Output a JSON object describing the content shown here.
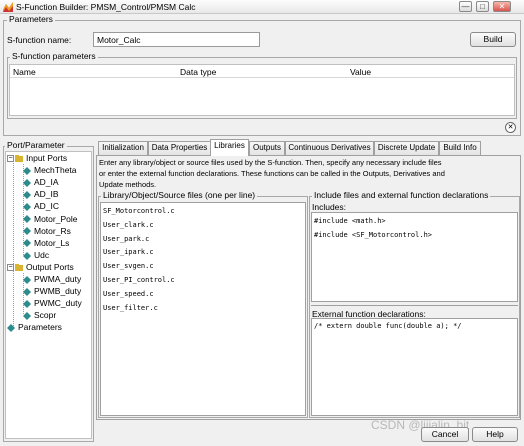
{
  "window": {
    "title": "S-Function Builder: PMSM_Control/PMSM Calc",
    "buttons": {
      "minimize": "—",
      "restore": "□",
      "close": "✕"
    }
  },
  "parameters": {
    "group_label": "Parameters",
    "name_label": "S-function name:",
    "name_value": "Motor_Calc",
    "build_label": "Build",
    "sfun_params_label": "S-function parameters",
    "columns": [
      "Name",
      "Data type",
      "Value"
    ]
  },
  "port_parameter": {
    "group_label": "Port/Parameter",
    "tree": [
      {
        "label": "Input Ports",
        "level": 0,
        "kind": "folder"
      },
      {
        "label": "MechTheta",
        "level": 1,
        "kind": "port"
      },
      {
        "label": "AD_IA",
        "level": 1,
        "kind": "port"
      },
      {
        "label": "AD_IB",
        "level": 1,
        "kind": "port"
      },
      {
        "label": "AD_IC",
        "level": 1,
        "kind": "port"
      },
      {
        "label": "Motor_Pole",
        "level": 1,
        "kind": "port"
      },
      {
        "label": "Motor_Rs",
        "level": 1,
        "kind": "port"
      },
      {
        "label": "Motor_Ls",
        "level": 1,
        "kind": "port"
      },
      {
        "label": "Udc",
        "level": 1,
        "kind": "port"
      },
      {
        "label": "Output Ports",
        "level": 0,
        "kind": "folder"
      },
      {
        "label": "PWMA_duty",
        "level": 1,
        "kind": "port"
      },
      {
        "label": "PWMB_duty",
        "level": 1,
        "kind": "port"
      },
      {
        "label": "PWMC_duty",
        "level": 1,
        "kind": "port"
      },
      {
        "label": "Scopr",
        "level": 1,
        "kind": "port"
      },
      {
        "label": "Parameters",
        "level": 0,
        "kind": "leaf"
      }
    ]
  },
  "tabs": [
    {
      "label": "Initialization",
      "active": false
    },
    {
      "label": "Data Properties",
      "active": false
    },
    {
      "label": "Libraries",
      "active": true
    },
    {
      "label": "Outputs",
      "active": false
    },
    {
      "label": "Continuous Derivatives",
      "active": false
    },
    {
      "label": "Discrete Update",
      "active": false
    },
    {
      "label": "Build Info",
      "active": false
    }
  ],
  "libraries": {
    "description_line1": "Enter any library/object or source files used by the S-function. Then, specify any necessary include files",
    "description_line2": "or enter the external function declarations. These functions can be called in the Outputs, Derivatives and",
    "description_line3": "Update methods.",
    "source_files_label": "Library/Object/Source files (one per line)",
    "source_files": [
      "SF_Motorcontrol.c",
      "User_clark.c",
      "User_park.c",
      "User_ipark.c",
      "User_svgen.c",
      "User_PI_control.c",
      "User_speed.c",
      "User_filter.c"
    ],
    "include_group_label": "Include files and external function declarations",
    "includes_label": "Includes:",
    "includes": [
      "#include <math.h>",
      "#include <SF_Motorcontrol.h>"
    ],
    "external_label": "External function declarations:",
    "external": "/* extern double func(double a); */"
  },
  "footer": {
    "cancel_label": "Cancel",
    "help_label": "Help",
    "watermark": "CSDN @lijialin_bit"
  },
  "colors": {
    "port_icon": "#2e8b8b",
    "folder_icon": "#d8b430",
    "titlebar_icon": "#cc3333"
  }
}
